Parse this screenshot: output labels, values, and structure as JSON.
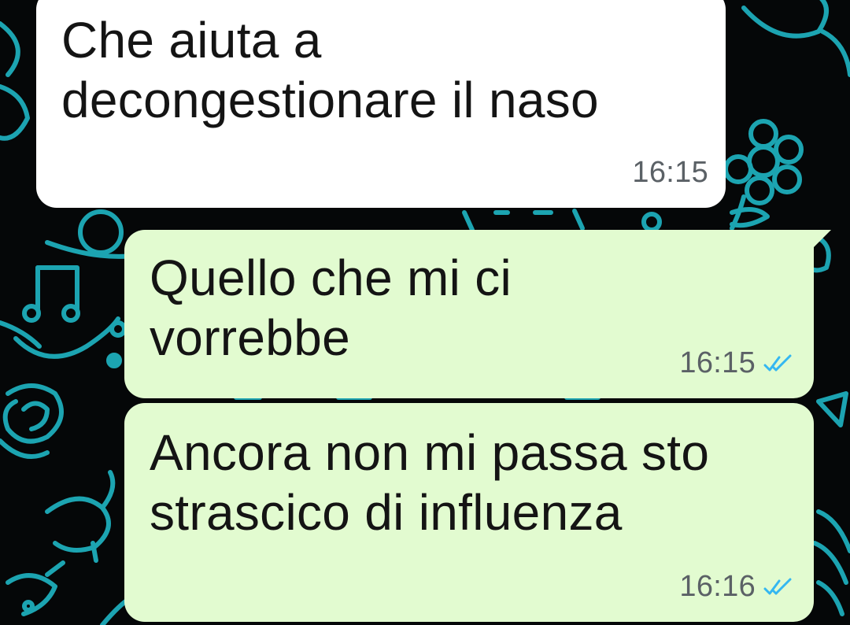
{
  "chat": {
    "messages": [
      {
        "direction": "incoming",
        "text": "Che aiuta a decongestionare il naso",
        "time": "16:15"
      },
      {
        "direction": "outgoing",
        "text": "Quello che mi ci vorrebbe",
        "time": "16:15",
        "status": "read"
      },
      {
        "direction": "outgoing",
        "text": "Ancora non mi passa sto strascico di influenza",
        "time": "16:16",
        "status": "read"
      }
    ]
  },
  "colors": {
    "background": "#050708",
    "doodle": "#1fb5c4",
    "incoming_bubble": "#ffffff",
    "outgoing_bubble": "#e2fbd0",
    "read_ticks": "#34b7f1"
  },
  "icons": [
    "double-check-icon"
  ]
}
